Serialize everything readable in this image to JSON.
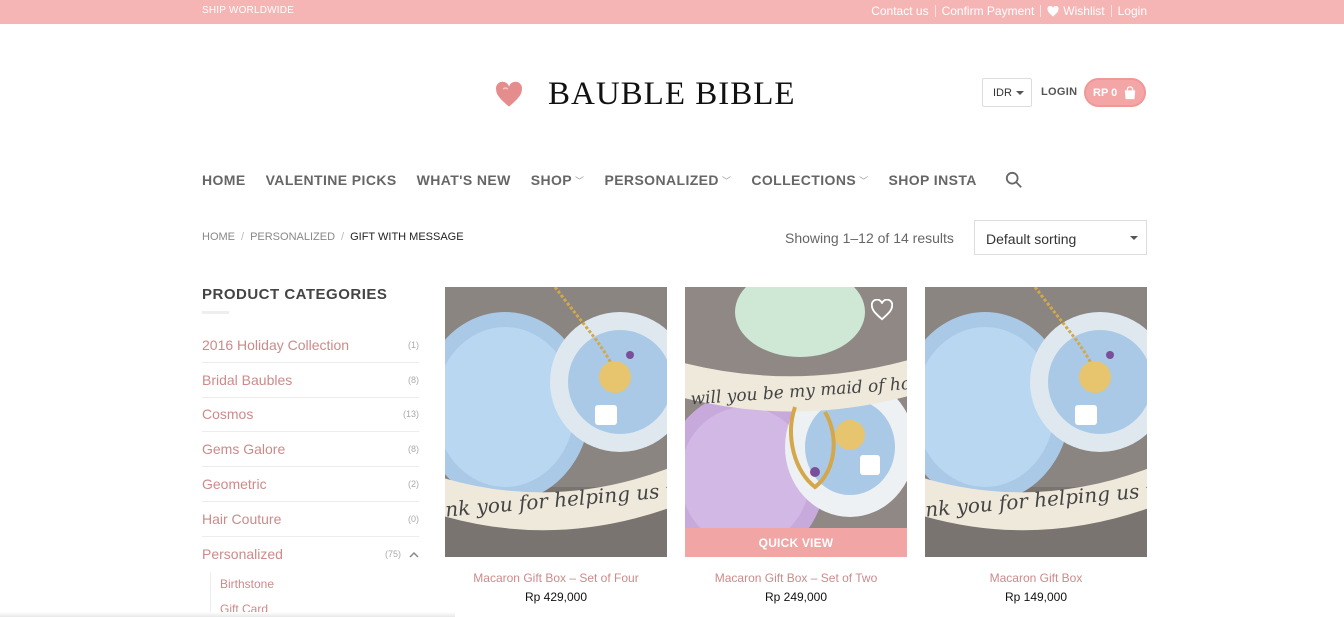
{
  "topbar": {
    "ship": "SHIP WORLDWIDE",
    "links": [
      "Contact us",
      "Confirm Payment",
      "Wishlist",
      "Login"
    ]
  },
  "header": {
    "brand": "BAUBLE BIBLE",
    "currency": "IDR",
    "login": "LOGIN",
    "cart": "RP 0"
  },
  "nav": {
    "items": [
      {
        "label": "HOME"
      },
      {
        "label": "VALENTINE PICKS"
      },
      {
        "label": "WHAT'S NEW"
      },
      {
        "label": "SHOP"
      },
      {
        "label": "PERSONALIZED"
      },
      {
        "label": "COLLECTIONS"
      },
      {
        "label": "SHOP INSTA"
      }
    ]
  },
  "breadcrumb": [
    "HOME",
    "PERSONALIZED",
    "GIFT WITH MESSAGE"
  ],
  "results": "Showing 1–12 of 14 results",
  "sorting": "Default sorting",
  "sidebar": {
    "title": "PRODUCT CATEGORIES",
    "categories": [
      {
        "name": "2016 Holiday Collection",
        "count": "(1)"
      },
      {
        "name": "Bridal Baubles",
        "count": "(8)"
      },
      {
        "name": "Cosmos",
        "count": "(13)"
      },
      {
        "name": "Gems Galore",
        "count": "(8)"
      },
      {
        "name": "Geometric",
        "count": "(2)"
      },
      {
        "name": "Hair Couture",
        "count": "(0)"
      },
      {
        "name": "Personalized",
        "count": "(75)"
      }
    ],
    "subcategories": [
      "Birthstone",
      "Gift Card"
    ]
  },
  "products": [
    {
      "name": "Macaron Gift Box – Set of Four",
      "price": "Rp 429,000",
      "ribbon": "nk you for helping us tie th"
    },
    {
      "name": "Macaron Gift Box – Set of Two",
      "price": "Rp 249,000",
      "ribbon": "will you be my maid of honour",
      "quick_view": "QUICK VIEW"
    },
    {
      "name": "Macaron Gift Box",
      "price": "Rp 149,000",
      "ribbon": "nk you for helping us tie th"
    }
  ],
  "colors": {
    "topbar": "#f6b5b5",
    "accent": "#cd8a8a",
    "quick_view": "#f1a5a5"
  }
}
